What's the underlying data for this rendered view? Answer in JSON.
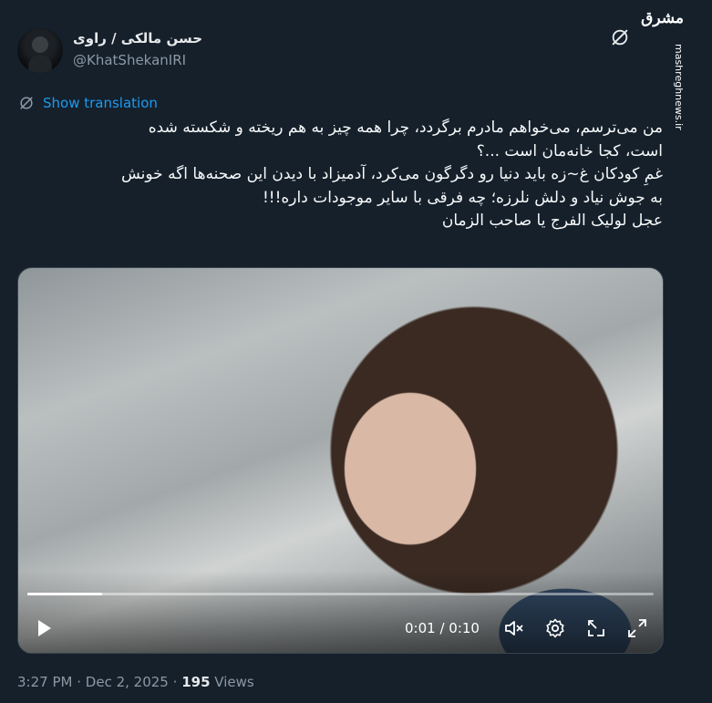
{
  "author": {
    "display_name": "حسن مالکی / راوی",
    "handle": "@KhatShekanIRI"
  },
  "watermark": {
    "logo_text": "مشرق",
    "site": "mashreghnews.ir"
  },
  "translate": {
    "label": "Show translation"
  },
  "tweet": {
    "lines": [
      "من می‌ترسم، می‌خواهم مادرم برگردد، چرا همه چیز به هم ریخته و شکسته شده",
      "است، کجا خانه‌مان است ...؟",
      "غمِ کودکان غ~زه باید دنیا رو دگرگون می‌کرد، آدمیزاد با دیدن این صحنه‌ها اگه خونش",
      "به جوش نیاد و دلش نلرزه؛ چه فرقی با سایر موجودات داره!!!",
      "عجل لولیک الفرج یا صاحب الزمان"
    ]
  },
  "video": {
    "elapsed": "0:01",
    "duration": "0:10",
    "time_text": "0:01 / 0:10",
    "progress": 0.12,
    "icons": [
      "play-icon",
      "mute-icon",
      "settings-icon",
      "pip-icon",
      "fullscreen-icon"
    ]
  },
  "meta": {
    "time": "3:27 PM",
    "date": "Dec 2, 2025",
    "views_count": "195",
    "views_label": "Views",
    "separator": "·"
  },
  "colors": {
    "background": "#15202b",
    "link": "#1d9bf0",
    "secondary_text": "#8b98a5"
  }
}
